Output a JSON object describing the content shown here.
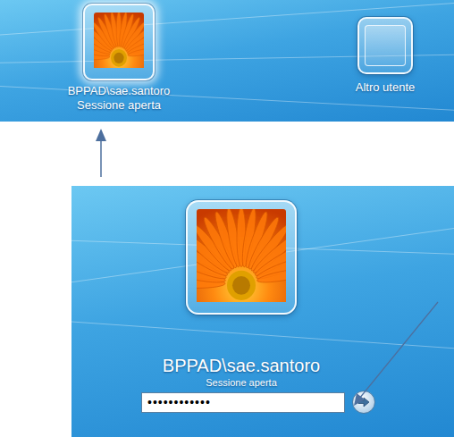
{
  "top_screen": {
    "tiles": [
      {
        "user": "BPPAD\\sae.santoro",
        "status": "Sessione aperta",
        "kind": "photo",
        "selected": true
      },
      {
        "user": "Altro utente",
        "kind": "empty",
        "selected": false
      }
    ]
  },
  "login_screen": {
    "user": "BPPAD\\sae.santoro",
    "status": "Sessione aperta",
    "password": "••••••••••••"
  }
}
